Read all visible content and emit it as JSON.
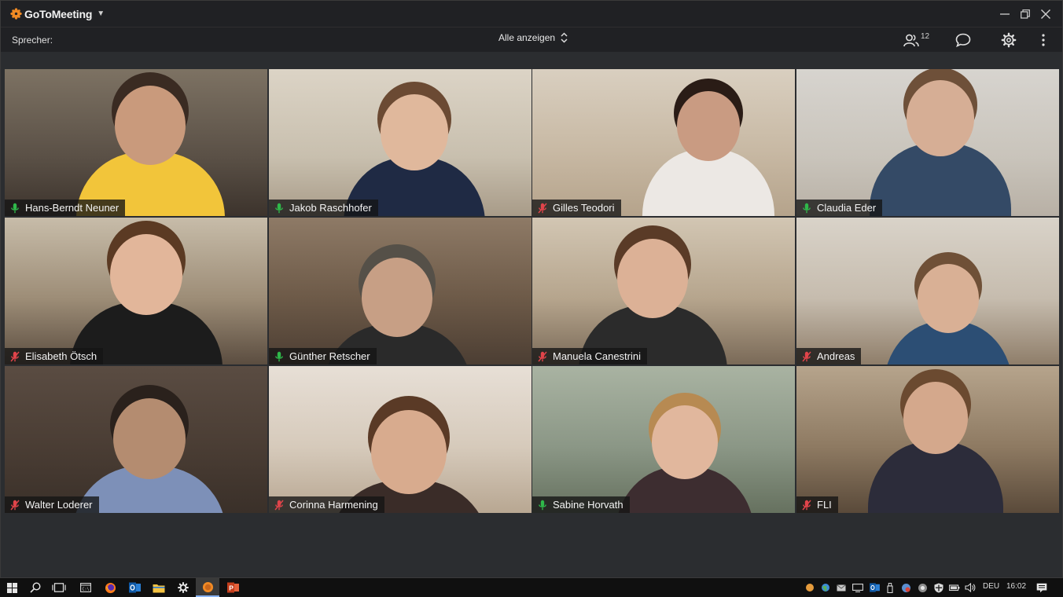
{
  "app": {
    "brand": "GoToMeeting",
    "brand_color": "#f08a24"
  },
  "toolbar": {
    "speaker_label": "Sprecher:",
    "view_mode": "Alle anzeigen",
    "participant_count": "12",
    "icons": [
      "participants-icon",
      "chat-icon",
      "settings-icon",
      "more-icon"
    ]
  },
  "participants": [
    {
      "name": "Hans-Berndt Neuner",
      "muted": false
    },
    {
      "name": "Jakob Raschhofer",
      "muted": false
    },
    {
      "name": "Gilles Teodori",
      "muted": true
    },
    {
      "name": "Claudia Eder",
      "muted": false
    },
    {
      "name": "Elisabeth Ötsch",
      "muted": true
    },
    {
      "name": "Günther Retscher",
      "muted": false
    },
    {
      "name": "Manuela Canestrini",
      "muted": true
    },
    {
      "name": "Andreas",
      "muted": true
    },
    {
      "name": "Walter Loderer",
      "muted": true
    },
    {
      "name": "Corinna Harmening",
      "muted": true
    },
    {
      "name": "Sabine Horvath",
      "muted": false
    },
    {
      "name": "FLI",
      "muted": true
    }
  ],
  "colors": {
    "mic_on": "#2fb84a",
    "mic_off": "#e0444a"
  },
  "taskbar": {
    "apps": [
      "windows-start-icon",
      "search-icon",
      "task-view-icon",
      "terminal-icon",
      "firefox-icon",
      "outlook-icon",
      "file-explorer-icon",
      "settings-icon",
      "gotomeeting-icon",
      "powerpoint-icon"
    ],
    "language": "DEU",
    "time": "16:02"
  }
}
